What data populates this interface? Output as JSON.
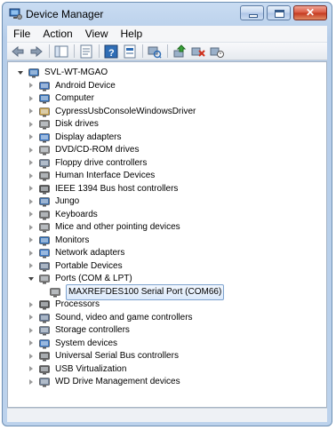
{
  "window": {
    "title": "Device Manager"
  },
  "menu": [
    "File",
    "Action",
    "View",
    "Help"
  ],
  "tree": {
    "root": "SVL-WT-MGAO",
    "categories": [
      {
        "label": "Android Device",
        "icon": "android-device-icon",
        "color": "#3c6fb8"
      },
      {
        "label": "Computer",
        "icon": "computer-icon",
        "color": "#2f6db5"
      },
      {
        "label": "CypressUsbConsoleWindowsDriver",
        "icon": "driver-icon",
        "color": "#c9a24a"
      },
      {
        "label": "Disk drives",
        "icon": "disk-drive-icon",
        "color": "#7d7d7d"
      },
      {
        "label": "Display adapters",
        "icon": "display-adapter-icon",
        "color": "#3a76c4"
      },
      {
        "label": "DVD/CD-ROM drives",
        "icon": "dvd-drive-icon",
        "color": "#8a8a8a"
      },
      {
        "label": "Floppy drive controllers",
        "icon": "floppy-controller-icon",
        "color": "#6f7f95"
      },
      {
        "label": "Human Interface Devices",
        "icon": "hid-icon",
        "color": "#6b6b6b"
      },
      {
        "label": "IEEE 1394 Bus host controllers",
        "icon": "ieee1394-icon",
        "color": "#4a4a4a"
      },
      {
        "label": "Jungo",
        "icon": "jungo-icon",
        "color": "#3e6ea8"
      },
      {
        "label": "Keyboards",
        "icon": "keyboard-icon",
        "color": "#6d6d6d"
      },
      {
        "label": "Mice and other pointing devices",
        "icon": "mouse-icon",
        "color": "#7a7a7a"
      },
      {
        "label": "Monitors",
        "icon": "monitor-icon",
        "color": "#2f6db5"
      },
      {
        "label": "Network adapters",
        "icon": "network-adapter-icon",
        "color": "#3a76c4"
      },
      {
        "label": "Portable Devices",
        "icon": "portable-device-icon",
        "color": "#5e6e86"
      },
      {
        "label": "Ports (COM & LPT)",
        "icon": "port-icon",
        "color": "#7a7a7a",
        "expanded": true,
        "children": [
          {
            "label": "MAXREFDES100 Serial Port (COM66)",
            "icon": "serial-port-icon",
            "color": "#7a7a7a"
          }
        ]
      },
      {
        "label": "Processors",
        "icon": "processor-icon",
        "color": "#4d4d4d"
      },
      {
        "label": "Sound, video and game controllers",
        "icon": "sound-icon",
        "color": "#5c6f8c"
      },
      {
        "label": "Storage controllers",
        "icon": "storage-controller-icon",
        "color": "#6f7f95"
      },
      {
        "label": "System devices",
        "icon": "system-device-icon",
        "color": "#3a76c4"
      },
      {
        "label": "Universal Serial Bus controllers",
        "icon": "usb-icon",
        "color": "#5c5c5c"
      },
      {
        "label": "USB Virtualization",
        "icon": "usb-virtualization-icon",
        "color": "#5c5c5c"
      },
      {
        "label": "WD Drive Management devices",
        "icon": "wd-drive-icon",
        "color": "#6f7f95"
      }
    ]
  },
  "colors": {
    "titlebar": "#c9dcf2",
    "selection_border": "#7da2ce",
    "close_button": "#c3371f"
  }
}
